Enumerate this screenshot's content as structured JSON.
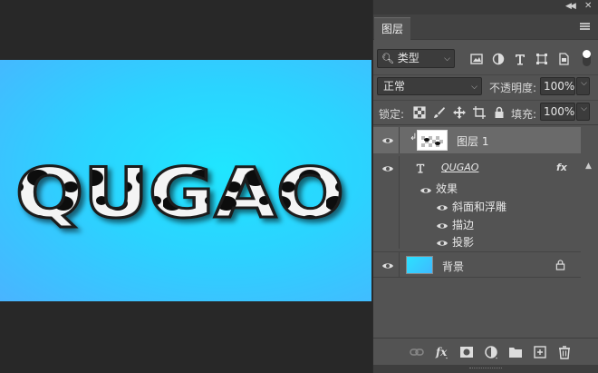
{
  "panel": {
    "tab_label": "图层",
    "filter": {
      "kind_label": "类型"
    },
    "blend_mode": "正常",
    "opacity_label": "不透明度:",
    "opacity_value": "100%",
    "lock_label": "锁定:",
    "fill_label": "填充:",
    "fill_value": "100%"
  },
  "layers": [
    {
      "name": "图层 1",
      "selected": true,
      "visible": true,
      "clipped": true
    },
    {
      "name": "QUGAO",
      "type": "text",
      "visible": true,
      "fx": "fx",
      "effects_label": "效果",
      "effects": [
        "斜面和浮雕",
        "描边",
        "投影"
      ]
    },
    {
      "name": "背景",
      "visible": true,
      "locked": true
    }
  ],
  "canvas": {
    "art_text": "QUGAO",
    "bg_colors": [
      "#1fe6ff",
      "#49b4ff"
    ]
  },
  "bottom_toolbar": [
    "link-icon",
    "fx-icon",
    "mask-icon",
    "adjustment-icon",
    "group-folder-icon",
    "new-layer-icon",
    "trash-icon"
  ]
}
